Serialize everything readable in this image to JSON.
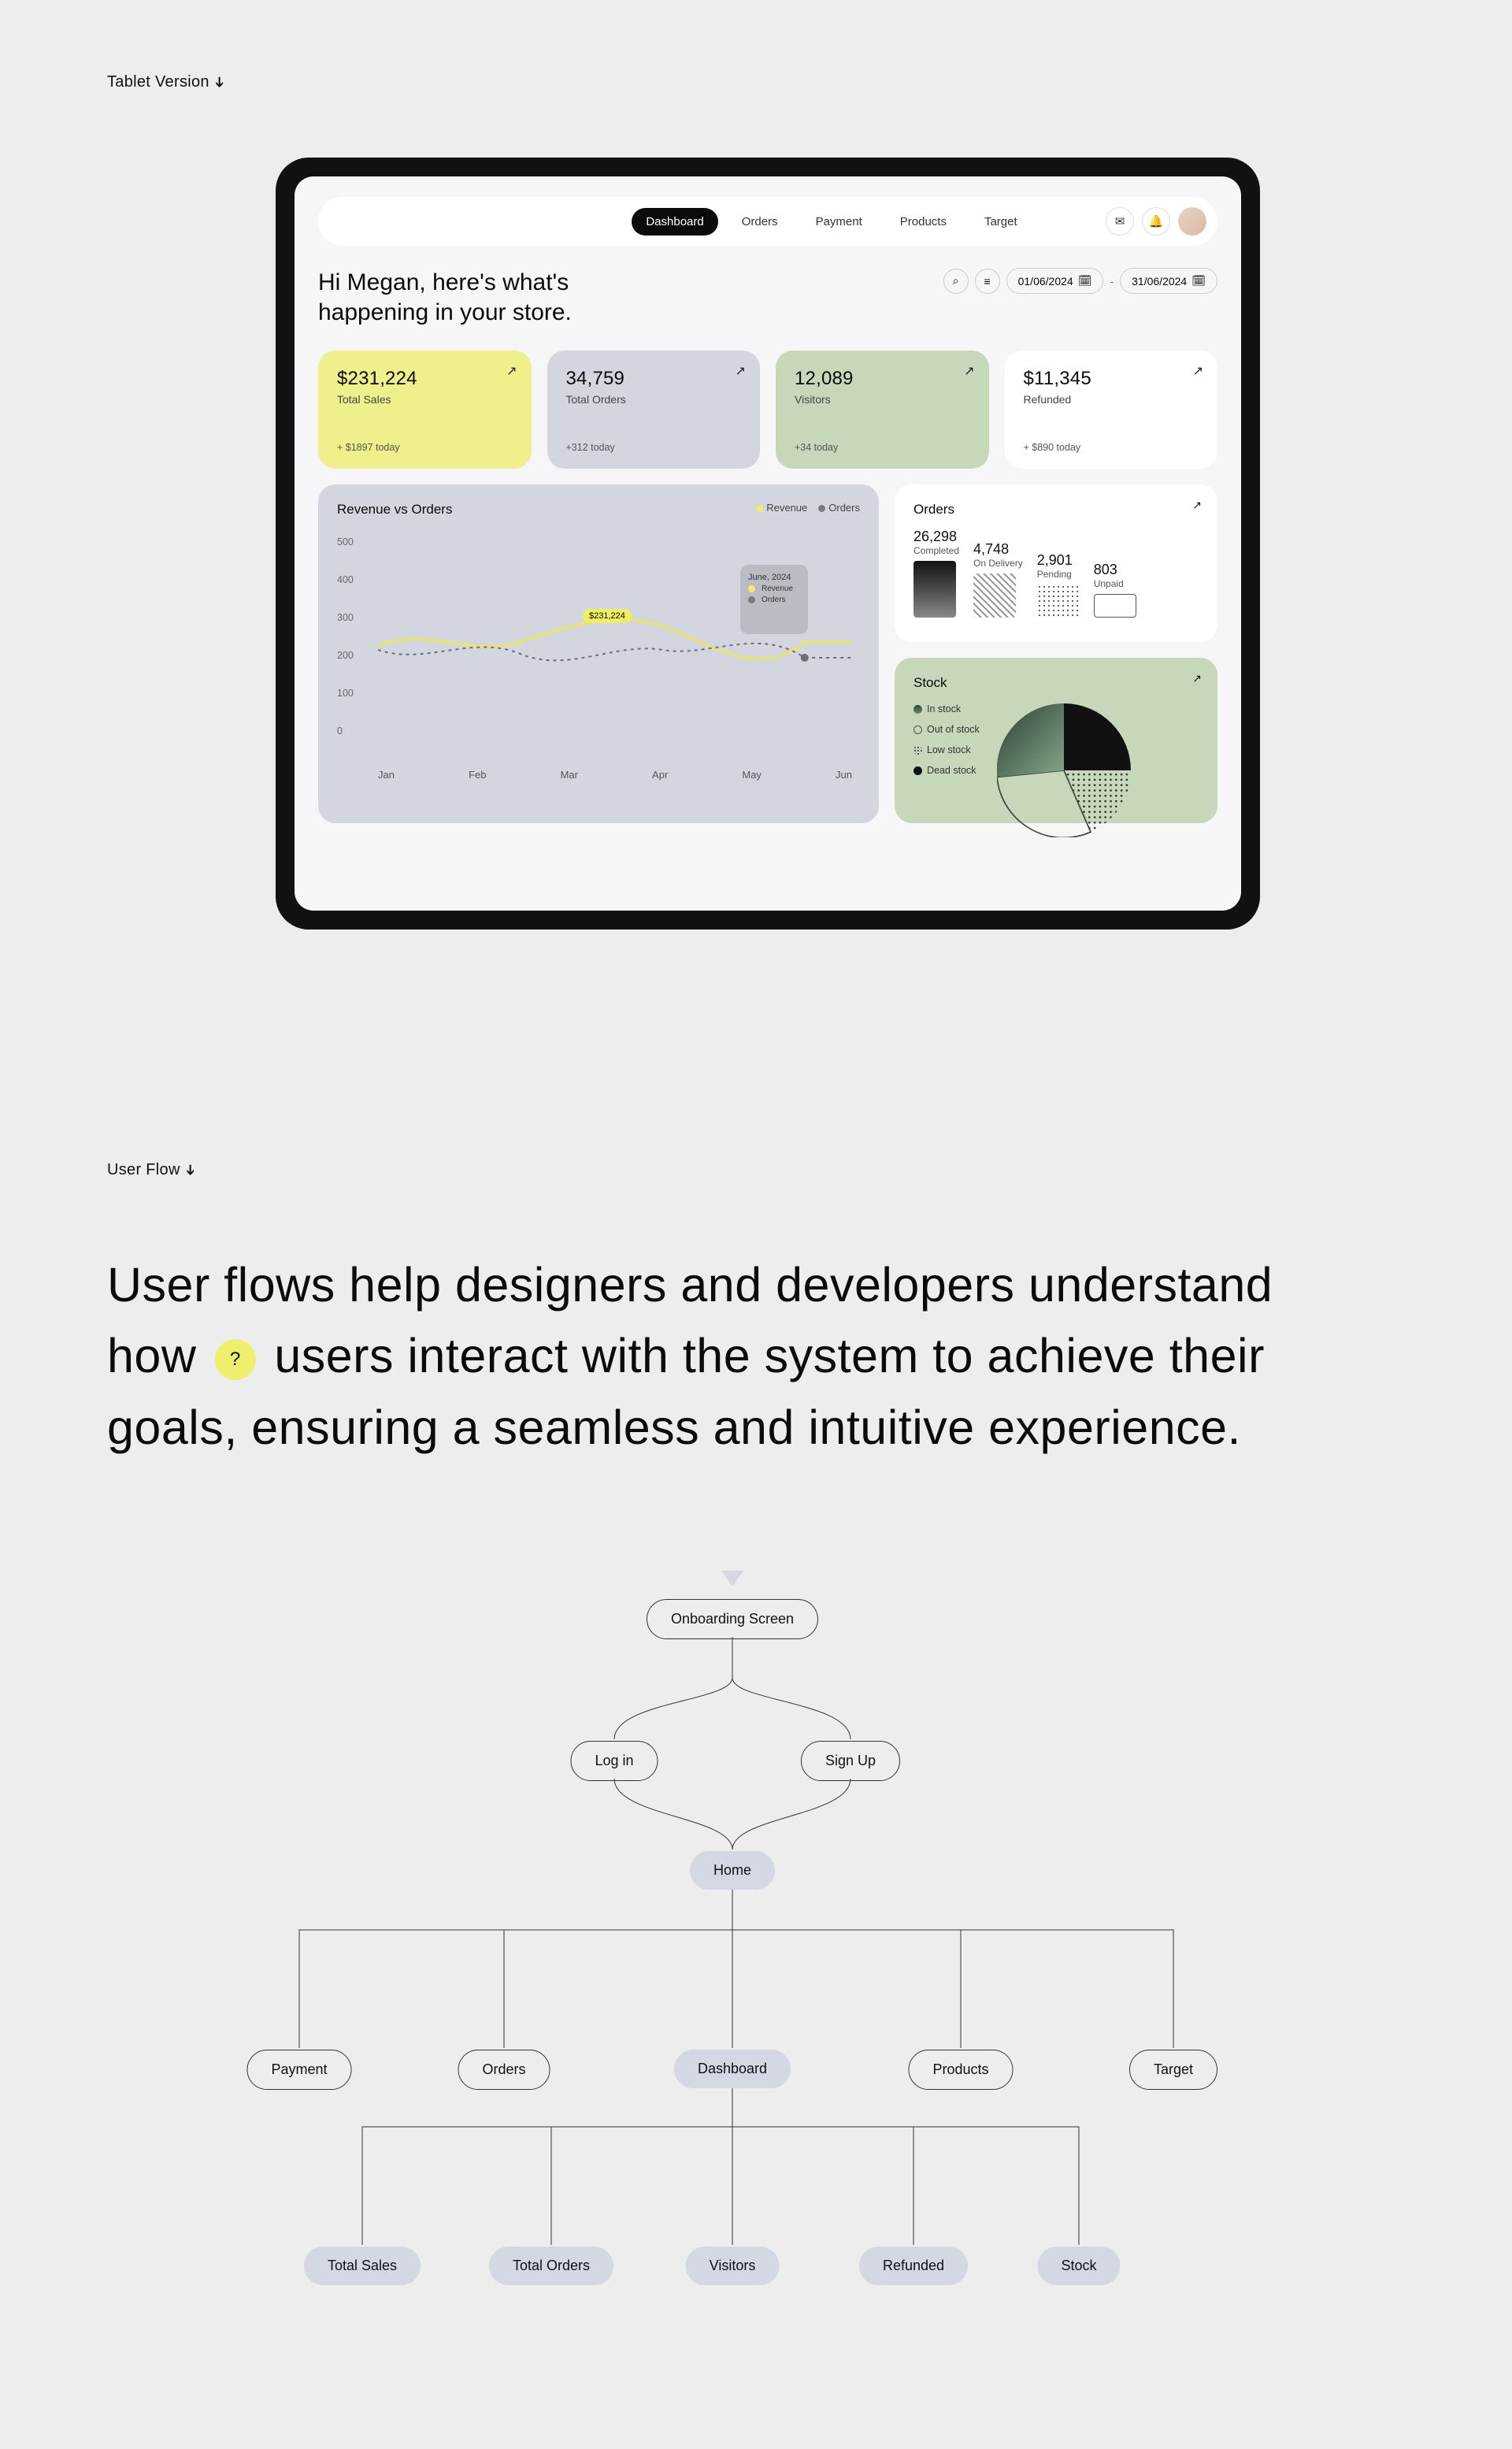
{
  "sections": {
    "tablet": "Tablet Version",
    "flow": "User Flow"
  },
  "nav": [
    "Dashboard",
    "Orders",
    "Payment",
    "Products",
    "Target"
  ],
  "greeting": "Hi Megan, here's what's happening in your store.",
  "dates": {
    "from": "01/06/2024",
    "to": "31/06/2024"
  },
  "kpi": [
    {
      "value": "$231,224",
      "label": "Total Sales",
      "foot": "+ $1897 today"
    },
    {
      "value": "34,759",
      "label": "Total Orders",
      "foot": "+312 today"
    },
    {
      "value": "12,089",
      "label": "Visitors",
      "foot": "+34 today"
    },
    {
      "value": "$11,345",
      "label": "Refunded",
      "foot": "+ $890 today"
    }
  ],
  "chart": {
    "title": "Revenue vs Orders",
    "legend": {
      "a": "Revenue",
      "b": "Orders"
    },
    "yticks": [
      "500",
      "400",
      "300",
      "200",
      "100",
      "0"
    ],
    "xticks": [
      "Jan",
      "Feb",
      "Mar",
      "Apr",
      "May",
      "Jun"
    ],
    "tooltip": {
      "title": "June, 2024",
      "a": "Revenue",
      "b": "Orders"
    },
    "pill": "$231,224"
  },
  "chart_data": {
    "type": "line",
    "title": "Revenue vs Orders",
    "xlabel": "",
    "ylabel": "",
    "ylim": [
      0,
      500
    ],
    "categories": [
      "Jan",
      "Feb",
      "Mar",
      "Apr",
      "May",
      "Jun"
    ],
    "series": [
      {
        "name": "Revenue",
        "values": [
          240,
          260,
          240,
          300,
          200,
          250
        ]
      },
      {
        "name": "Orders",
        "values": [
          240,
          230,
          260,
          260,
          280,
          230
        ]
      }
    ]
  },
  "orders": {
    "title": "Orders",
    "items": [
      {
        "n": "26,298",
        "l": "Completed"
      },
      {
        "n": "4,748",
        "l": "On Delivery"
      },
      {
        "n": "2,901",
        "l": "Pending"
      },
      {
        "n": "803",
        "l": "Unpaid"
      }
    ]
  },
  "stock": {
    "title": "Stock",
    "items": [
      "In stock",
      "Out of stock",
      "Low stock",
      "Dead stock"
    ]
  },
  "flow_text": {
    "pre": "User flows help designers and developers understand how",
    "post": "users interact with the system to achieve their goals, ensuring a seamless and intuitive experience."
  },
  "flow_nodes": {
    "onboard": "Onboarding Screen",
    "login": "Log in",
    "signup": "Sign Up",
    "home": "Home",
    "payment": "Payment",
    "orders": "Orders",
    "dashboard": "Dashboard",
    "products": "Products",
    "target": "Target",
    "totalsales": "Total Sales",
    "totalorders": "Total Orders",
    "visitors": "Visitors",
    "refunded": "Refunded",
    "stock": "Stock"
  }
}
